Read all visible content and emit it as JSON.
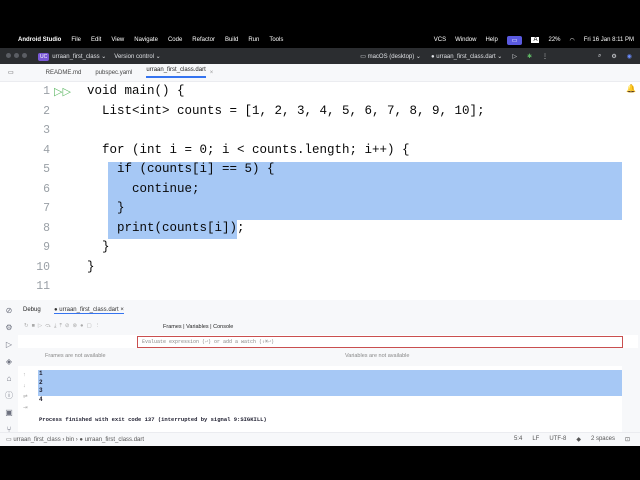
{
  "menubar": {
    "app": "Android Studio",
    "items": [
      "File",
      "Edit",
      "View",
      "Navigate",
      "Code",
      "Refactor",
      "Build",
      "Run",
      "Tools",
      "VCS",
      "Window",
      "Help"
    ],
    "battery": "22%",
    "datetime": "Fri 16 Jan 8:11 PM",
    "input": "A"
  },
  "toolbar": {
    "project_badge": "UC",
    "project": "urraan_first_class",
    "vcs": "Version control",
    "device": "macOS (desktop)",
    "run_config": "urraan_first_class.dart"
  },
  "tabs": [
    {
      "label": "README.md"
    },
    {
      "label": "pubspec.yaml"
    },
    {
      "label": "urraan_first_class.dart",
      "active": true
    }
  ],
  "editor": {
    "line_numbers": [
      "1",
      "2",
      "3",
      "4",
      "5",
      "6",
      "7",
      "8",
      "9",
      "10",
      "11"
    ],
    "lines": [
      "void main() {",
      "  List<int> counts = [1, 2, 3, 4, 5, 6, 7, 8, 9, 10];",
      "",
      "  for (int i = 0; i < counts.length; i++) {",
      "    if (counts[i] == 5) {",
      "      continue;",
      "    }",
      "    print(counts[i]);",
      "  }",
      "}",
      ""
    ]
  },
  "debug": {
    "tab_debug": "Debug",
    "tab_session": "urraan_first_class.dart",
    "subtabs": "Frames | Variables | Console",
    "eval_placeholder": "Evaluate expression (⏎) or add a watch (⇧⌘⏎)",
    "frames_empty": "Frames are not available",
    "variables_empty": "Variables are not available",
    "console": [
      "1",
      "2",
      "3",
      "4"
    ],
    "process_msg": "Process finished with exit code 137 (interrupted by signal 9:SIGKILL)"
  },
  "status": {
    "breadcrumb": [
      "urraan_first_class",
      "bin",
      "urraan_first_class.dart"
    ],
    "position": "5:4",
    "line_sep": "LF",
    "encoding": "UTF-8",
    "indent": "2 spaces"
  }
}
